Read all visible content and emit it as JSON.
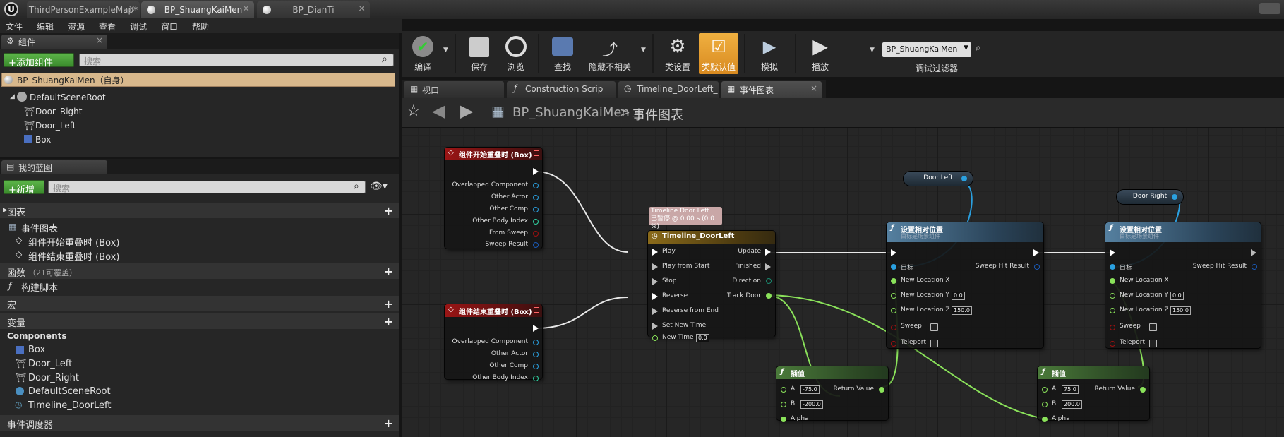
{
  "doc_tabs": [
    {
      "label": "ThirdPersonExampleMap*"
    },
    {
      "label": "BP_ShuangKaiMen"
    },
    {
      "label": "BP_DianTi"
    }
  ],
  "menu": [
    "文件",
    "编辑",
    "资源",
    "查看",
    "调试",
    "窗口",
    "帮助"
  ],
  "components_panel": {
    "tab": "组件",
    "add_button": "+添加组件",
    "search_placeholder": "搜索",
    "root_item": "BP_ShuangKaiMen（自身）",
    "tree": [
      "DefaultSceneRoot",
      "Door_Right",
      "Door_Left",
      "Box"
    ]
  },
  "myblueprint_panel": {
    "tab": "我的蓝图",
    "new_button": "+新增",
    "search_placeholder": "搜索",
    "graphs_label": "图表",
    "event_graph": "事件图表",
    "events": [
      "组件开始重叠时 (Box)",
      "组件结束重叠时 (Box)"
    ],
    "functions_label": "函数",
    "functions_count": "（21可覆盖）",
    "construction_script": "构建脚本",
    "macros_label": "宏",
    "variables_label": "变量",
    "components_label": "Components",
    "component_vars": [
      "Box",
      "Door_Left",
      "Door_Right",
      "DefaultSceneRoot",
      "Timeline_DoorLeft"
    ],
    "dispatchers_label": "事件调度器"
  },
  "toolbar": {
    "buttons": [
      "编译",
      "保存",
      "浏览",
      "查找",
      "隐藏不相关",
      "类设置",
      "类默认值",
      "模拟",
      "播放"
    ],
    "debug_select": "BP_ShuangKaiMen",
    "debug_filter": "调试过滤器"
  },
  "graph_tabs": [
    "视口",
    "Construction Scrip",
    "Timeline_DoorLeft_",
    "事件图表"
  ],
  "breadcrumb": {
    "blueprint": "BP_ShuangKaiMen",
    "separator": ">",
    "graph": "事件图表"
  },
  "nodes": {
    "begin_overlap": {
      "title": "组件开始重叠时 (Box)",
      "pins": [
        "Overlapped Component",
        "Other Actor",
        "Other Comp",
        "Other Body Index",
        "From Sweep",
        "Sweep Result"
      ]
    },
    "end_overlap": {
      "title": "组件结束重叠时 (Box)",
      "pins": [
        "Overlapped Component",
        "Other Actor",
        "Other Comp",
        "Other Body Index"
      ]
    },
    "timeline": {
      "title": "Timeline_DoorLeft",
      "comment_line1": "Timeline Door Left",
      "comment_line2": "已暂停 @ 0.00 s (0.0 %)",
      "inputs": [
        "Play",
        "Play from Start",
        "Stop",
        "Reverse",
        "Reverse from End",
        "Set New Time",
        "New Time"
      ],
      "new_time": "0.0",
      "outputs": [
        "Update",
        "Finished",
        "Direction",
        "Track Door"
      ]
    },
    "door_left_var": "Door Left",
    "door_right_var": "Door Right",
    "set_rel_1": {
      "title": "设置相对位置",
      "subtitle": "目标是场景组件",
      "target": "目标",
      "sweep_hit": "Sweep Hit Result",
      "lx": "New Location X",
      "ly": "New Location Y",
      "ly_val": "0.0",
      "lz": "New Location Z",
      "lz_val": "150.0",
      "sweep": "Sweep",
      "teleport": "Teleport"
    },
    "set_rel_2": {
      "title": "设置相对位置",
      "subtitle": "目标是场景组件",
      "target": "目标",
      "sweep_hit": "Sweep Hit Result",
      "lx": "New Location X",
      "ly": "New Location Y",
      "ly_val": "0.0",
      "lz": "New Location Z",
      "lz_val": "150.0",
      "sweep": "Sweep",
      "teleport": "Teleport"
    },
    "lerp_1": {
      "title": "插值",
      "a": "A",
      "a_val": "-75.0",
      "b": "B",
      "b_val": "-200.0",
      "alpha": "Alpha",
      "ret": "Return Value"
    },
    "lerp_2": {
      "title": "插值",
      "a": "A",
      "a_val": "75.0",
      "b": "B",
      "b_val": "200.0",
      "alpha": "Alpha",
      "ret": "Return Value"
    }
  },
  "colors": {
    "accent_selected": "#e8a83a",
    "event_red": "#9a1515",
    "exec_white": "#ffffff",
    "float_green": "#8ae25a",
    "object_blue": "#2aa0e0"
  }
}
